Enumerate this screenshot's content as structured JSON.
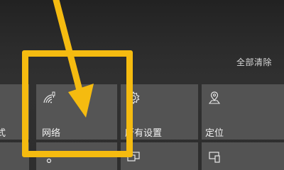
{
  "action_center": {
    "clear_all_label": "全部清除"
  },
  "tiles": {
    "partial_left_label": "式",
    "network_label": "网络",
    "all_settings_label": "所有设置",
    "location_label": "定位"
  },
  "icons": {
    "network": "wifi-signal-icon",
    "settings": "gear-icon",
    "location": "map-pin-icon",
    "row2_left": "share-nodes-icon",
    "row2_middle": "project-display-icon",
    "row2_right": "connect-device-icon"
  },
  "annotation": {
    "highlight_color": "#f5bb10",
    "arrow_color": "#f5bb10"
  },
  "colors": {
    "tile_bg": "#535353",
    "panel_bg": "#2e2e2e",
    "text": "#f2f2f2"
  }
}
